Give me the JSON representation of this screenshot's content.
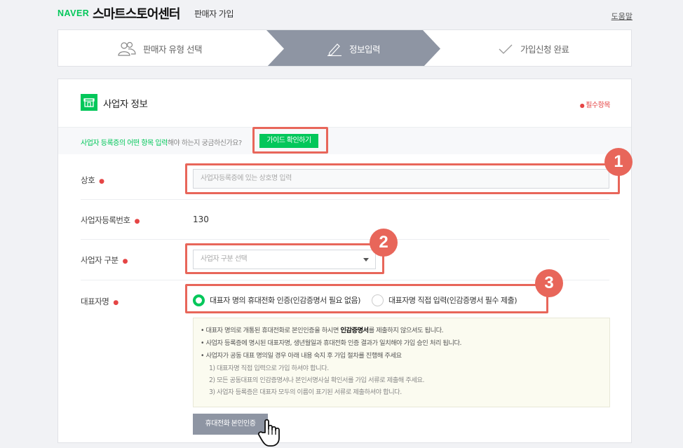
{
  "header": {
    "brand": "NAVER",
    "title": "스마트스토어센터",
    "subtitle": "판매자 가입",
    "help": "도움말"
  },
  "steps": [
    {
      "label": "판매자 유형 선택",
      "icon": "users-icon"
    },
    {
      "label": "정보입력",
      "icon": "pencil-icon"
    },
    {
      "label": "가입신청 완료",
      "icon": "check-icon"
    }
  ],
  "section": {
    "title": "사업자 정보",
    "required_note": "필수항목",
    "guide_text_green": "사업자 등록증의 어떤 항목 입력",
    "guide_text_gray": "해야 하는지 궁금하신가요?",
    "guide_button": "가이드 확인하기"
  },
  "form": {
    "shop_label": "상호",
    "shop_placeholder": "사업자등록증에 있는 상호명 입력",
    "bizno_label": "사업자등록번호",
    "bizno_value": "130",
    "biztype_label": "사업자 구분",
    "biztype_placeholder": "사업자 구분 선택",
    "rep_label": "대표자명",
    "radio1": "대표자 명의 휴대전화 인증(인감증명서 필요 없음)",
    "radio2": "대표자명 직접 입력(인감증명서 필수 제출)"
  },
  "notice": {
    "line1_pre": "• 대표자 명의로 개통된 휴대전화로 본인인증을 하시면 ",
    "line1_bold": "인감증명서",
    "line1_post": "를 제출하지 않으셔도 됩니다.",
    "line2": "• 사업자 등록증에 명시된 대표자명, 생년월일과 휴대전화 인증 결과가 일치해야 가입 승인 처리 됩니다.",
    "line3": "• 사업자가 공동 대표 명의일 경우 아래 내용 숙지 후 가입 절차를 진행해 주세요",
    "sub1": "1) 대표자명 직접 입력으로 가입 하셔야 합니다.",
    "sub2": "2) 모든 공동대표의 인감증명서나 본인서명사실 확인서를 가입 서류로 제출해 주세요.",
    "sub3": "3) 사업자 등록증은 대표자 모두의 이름이 표기된 서류로 제출하셔야 합니다."
  },
  "phone_button": "휴대전화 본인인증",
  "badges": [
    "1",
    "2",
    "3"
  ],
  "colors": {
    "brand": "#03c75a",
    "highlight": "#e8665a",
    "required": "#e54545",
    "step_active": "#8e95a3"
  }
}
